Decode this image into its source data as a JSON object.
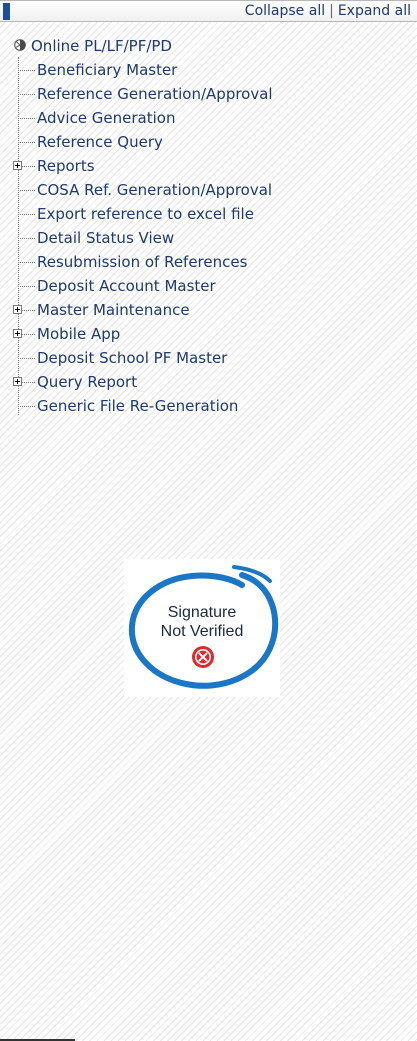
{
  "header": {
    "collapse_label": "Collapse all",
    "separator": "|",
    "expand_label": "Expand all",
    "accent_color": "#1d4f9a"
  },
  "tree": {
    "root_label": "Online PL/LF/PF/PD",
    "items": [
      {
        "label": "Beneficiary Master",
        "expandable": false
      },
      {
        "label": "Reference Generation/Approval",
        "expandable": false
      },
      {
        "label": "Advice Generation",
        "expandable": false
      },
      {
        "label": "Reference Query",
        "expandable": false
      },
      {
        "label": "Reports",
        "expandable": true
      },
      {
        "label": "COSA Ref. Generation/Approval",
        "expandable": false
      },
      {
        "label": "Export reference to excel file",
        "expandable": false
      },
      {
        "label": "Detail Status View",
        "expandable": false
      },
      {
        "label": "Resubmission of References",
        "expandable": false
      },
      {
        "label": "Deposit Account Master",
        "expandable": false
      },
      {
        "label": "Master Maintenance",
        "expandable": true
      },
      {
        "label": "Mobile App",
        "expandable": true
      },
      {
        "label": "Deposit School PF Master",
        "expandable": false
      },
      {
        "label": "Query Report",
        "expandable": true
      },
      {
        "label": "Generic File Re-Generation",
        "expandable": false
      }
    ]
  },
  "signature": {
    "line1": "Signature",
    "line2": "Not Verified",
    "ring_color": "#1a77c8",
    "badge_color": "#e5262d",
    "badge_icon": "x-circle-icon"
  }
}
